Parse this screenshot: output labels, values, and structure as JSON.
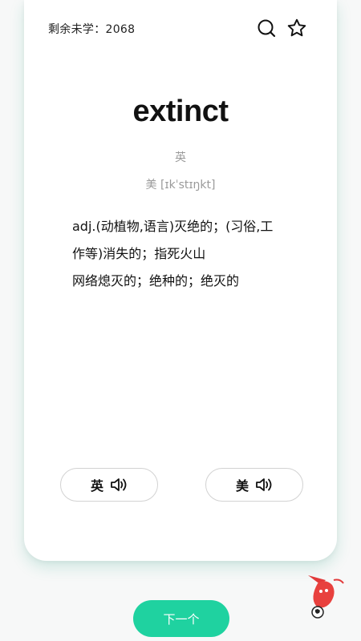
{
  "header": {
    "remaining_label": "剩余未学：2068",
    "icons": {
      "search": "search-icon",
      "favorite": "star-icon"
    }
  },
  "word": {
    "text": "extinct",
    "phonetic_uk": "英",
    "phonetic_us": "美 [ɪkˈstɪŋkt]"
  },
  "definitions": [
    "adj.(动植物,语言)灭绝的；(习俗,工",
    "作等)消失的；指死火山",
    "网络熄灭的；绝种的；绝灭的"
  ],
  "audio_buttons": {
    "uk": "英",
    "us": "美",
    "icon": "speaker-icon"
  },
  "next_button": "下一个",
  "colors": {
    "accent": "#1fd2a0",
    "card": "#ffffff",
    "background": "#f7f8f8",
    "muted_text": "#9a9a9a"
  }
}
